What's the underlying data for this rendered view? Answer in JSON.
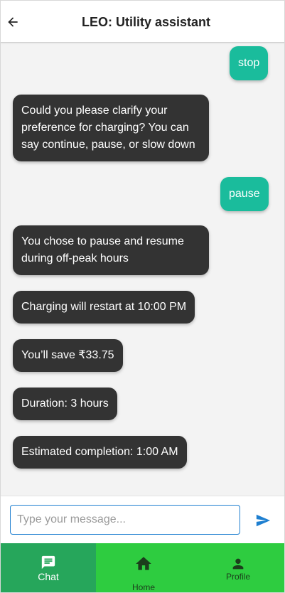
{
  "header": {
    "title": "LEO: Utility assistant",
    "back_icon": "arrow-left-icon"
  },
  "messages": [
    {
      "sender": "user",
      "text": "stop"
    },
    {
      "sender": "bot",
      "text": "Could you please clarify your preference for charging? You can say continue, pause, or slow down"
    },
    {
      "sender": "user",
      "text": "pause"
    },
    {
      "sender": "bot",
      "text": "You chose to pause and resume during off-peak hours"
    },
    {
      "sender": "bot",
      "text": "Charging will restart at 10:00 PM"
    },
    {
      "sender": "bot",
      "text": "You’ll save ₹33.75"
    },
    {
      "sender": "bot",
      "text": "Duration: 3 hours"
    },
    {
      "sender": "bot",
      "text": "Estimated completion: 1:00 AM"
    }
  ],
  "composer": {
    "placeholder": "Type your message...",
    "value": "",
    "send_icon": "send-icon"
  },
  "nav": {
    "items": [
      {
        "label": "Chat",
        "icon": "chat-icon",
        "active": true
      },
      {
        "label": "Home",
        "icon": "home-icon",
        "active": false
      },
      {
        "label": "Profile",
        "icon": "person-icon",
        "active": false
      }
    ]
  },
  "colors": {
    "user_bubble": "#1abc9c",
    "bot_bubble": "#333333",
    "nav_bar": "#2ecc40",
    "nav_active": "#26a65b",
    "input_border": "#1e7fd0",
    "send_icon": "#1e7fd0"
  }
}
